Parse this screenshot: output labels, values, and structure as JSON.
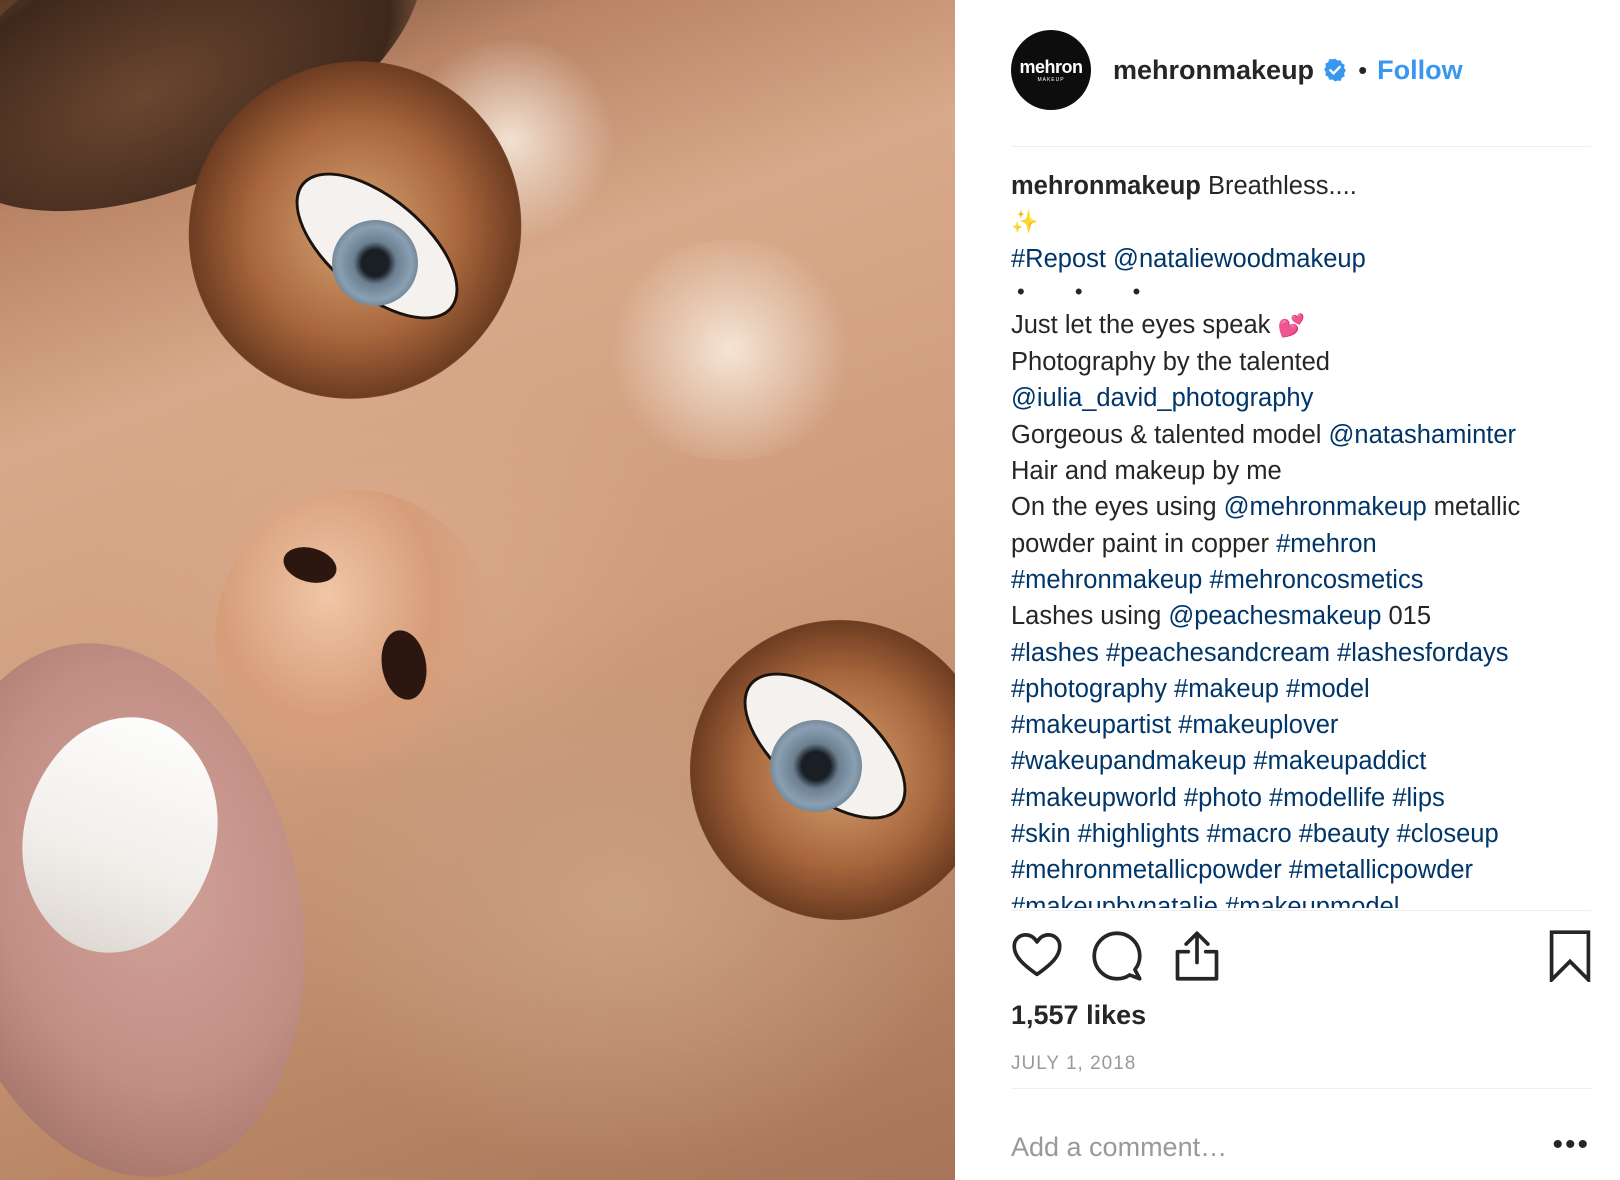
{
  "post": {
    "photo_alt": "Close-up of model with copper metallic eyeshadow",
    "account": {
      "avatar_logo": "mehron",
      "avatar_sub": "MAKEUP",
      "username": "mehronmakeup",
      "verified": true,
      "separator": "•",
      "follow_label": "Follow"
    },
    "caption": {
      "author": "mehronmakeup",
      "first_text": "Breathless....",
      "sparkle": "✨",
      "repost": "#Repost @nataliewoodmakeup",
      "dots": "• • •",
      "l1_text": "Just let the eyes speak ",
      "l1_emoji": "💕",
      "l2_text": "Photography by the talented",
      "l3_link": "@iulia_david_photography",
      "l4_text": "Gorgeous & talented model ",
      "l4_link": "@natashaminter",
      "l5_text": "Hair and makeup by me",
      "l6_text": "On the eyes using ",
      "l6_link": "@mehronmakeup",
      "l6_text2": " metallic",
      "l7_text": "powder paint in copper ",
      "l7_link": "#mehron",
      "l8_link": "#mehronmakeup #mehroncosmetics",
      "l9_text": "Lashes using ",
      "l9_link": "@peachesmakeup",
      "l9_text2": " 015",
      "l10_link": "#lashes #peachesandcream #lashesfordays",
      "l11_link": "#photography #makeup #model",
      "l12_link": "#makeupartist #makeuplover",
      "l13_link": "#wakeupandmakeup #makeupaddict",
      "l14_link": "#makeupworld #photo #modellife #lips",
      "l15_link": "#skin #highlights #macro #beauty #closeup",
      "l16_link": "#mehronmetallicpowder #metallicpowder",
      "l17_link": "#makeupbynatalie #makeupmodel"
    },
    "actions": {
      "like_icon": "heart-icon",
      "comment_icon": "speech-bubble-icon",
      "share_icon": "share-icon",
      "save_icon": "bookmark-icon"
    },
    "likes": "1,557 likes",
    "date": "JULY 1, 2018",
    "comment_placeholder": "Add a comment…",
    "more_label": "•••"
  },
  "colors": {
    "link": "#003569",
    "follow": "#3897f0",
    "verified": "#3897f0",
    "muted": "#999999",
    "text": "#262626"
  }
}
